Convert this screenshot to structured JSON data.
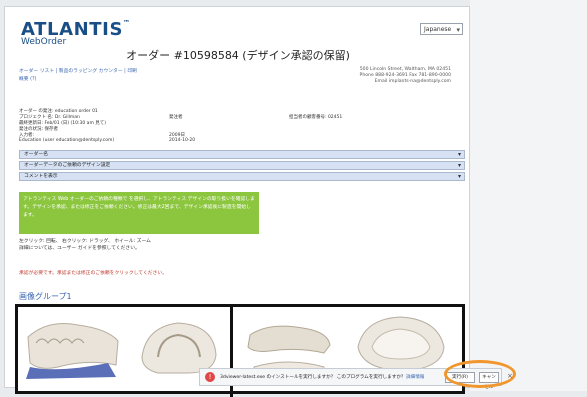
{
  "brand": {
    "name": "ATLANTIS",
    "tm": "™",
    "product": "WebOrder"
  },
  "language_select": {
    "value": "Japanese"
  },
  "page_title": "オーダー #10598584 (デザイン承認の保留)",
  "breadcrumb": {
    "line1": "オーダー リスト | 製品のラッピング カウンター | 印刷",
    "line2": "概要 (?)"
  },
  "address": {
    "line1": "500 Lincoln Street, Waltham, MA 02451",
    "line2": "Phone 888-924-3691  Fax 781-890-0000",
    "line3": "Email implants-na@dentsply.com"
  },
  "details": {
    "rows": [
      {
        "c1": "オーダー の発注: education order 01",
        "c2": "",
        "c3": ""
      },
      {
        "c1": "プロジェクト 名: Dr. Gillman",
        "c2": "発注者",
        "c3": "担当者の顧客番号: 02451"
      },
      {
        "c1": "最終更新日: Feb/01 (日) (10:30 am 見て)",
        "c2": "",
        "c3": ""
      },
      {
        "c1": "発注の状況: 保存者",
        "c2": "",
        "c3": ""
      },
      {
        "c1": "入力者:",
        "c2": "2009日",
        "c3": ""
      },
      {
        "c1": "Education (user education@dentsply.com)",
        "c2": "2014-10-20",
        "c3": ""
      }
    ]
  },
  "sections": [
    {
      "label": "オーダー名"
    },
    {
      "label": "オーダーデータのご依頼のデザイン設定"
    },
    {
      "label": "コメントを表示"
    }
  ],
  "note_text": "アトランティス Web オーダーのご依頼の種類で を選択し、アトランティス デザインの取り扱いを確認します。デザインを承認、または修正をご依頼ください。修正は最大2回まで、デザイン承認後に製造を開始します。",
  "info": {
    "line1": "左クリック: 回転、 右クリック: ドラッグ、 ホイール: ズーム",
    "line2": "詳細については、ユーザー ガイドを参照してください。"
  },
  "warning": "承認が必要です。承認または修正のご依頼をクリックしてください。",
  "group_title": "画像グループ1",
  "download_bar": {
    "message": "3dviewer-latest.exe のインストールを実行しますか？ このプログラムを実行しますか？",
    "link": "詳細情報",
    "run_button": "実行(R)",
    "cancel_button": "キャンセル",
    "close": "×"
  }
}
